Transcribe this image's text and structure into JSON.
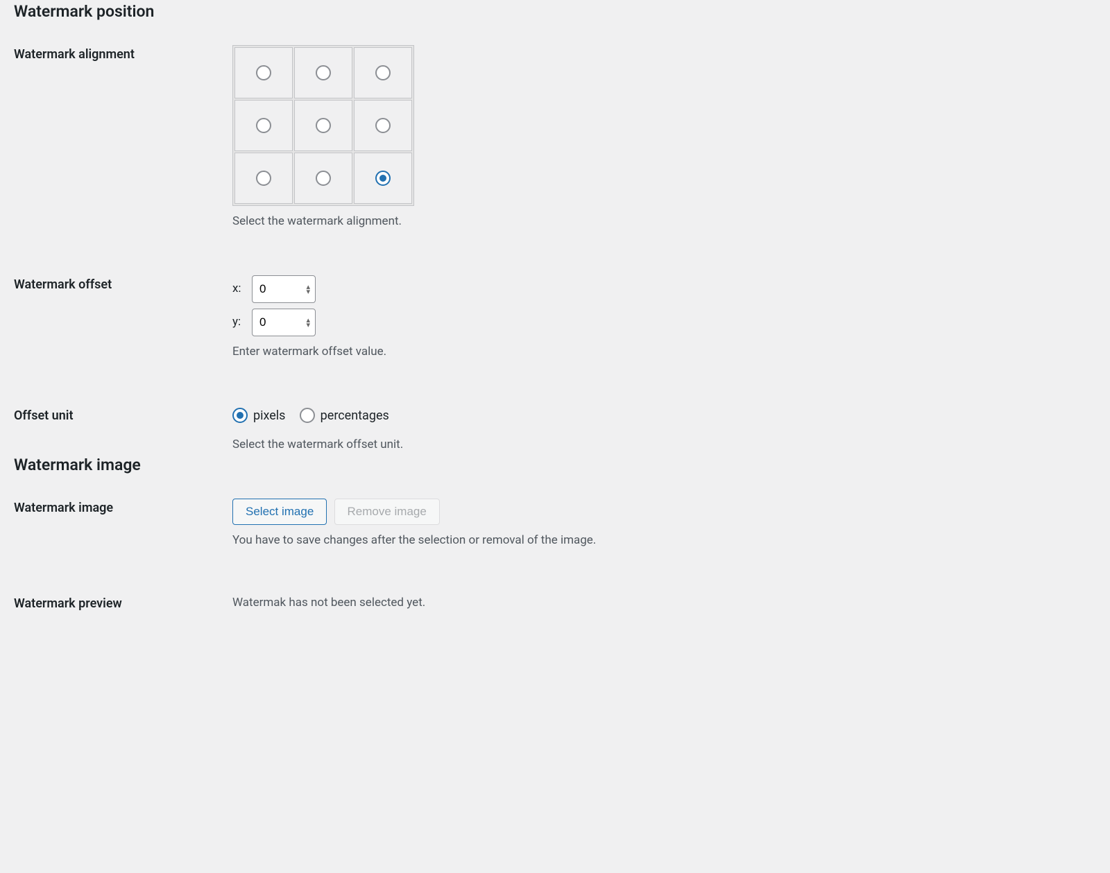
{
  "sections": {
    "position_heading": "Watermark position",
    "image_heading": "Watermark image"
  },
  "alignment": {
    "label": "Watermark alignment",
    "description": "Select the watermark alignment.",
    "selected": "bottom_right"
  },
  "offset": {
    "label": "Watermark offset",
    "x_label": "x:",
    "y_label": "y:",
    "x_value": "0",
    "y_value": "0",
    "description": "Enter watermark offset value."
  },
  "offset_unit": {
    "label": "Offset unit",
    "selected": "pixels",
    "options": {
      "pixels": "pixels",
      "percentages": "percentages"
    },
    "description": "Select the watermark offset unit."
  },
  "image": {
    "label": "Watermark image",
    "select_button": "Select image",
    "remove_button": "Remove image",
    "description": "You have to save changes after the selection or removal of the image."
  },
  "preview": {
    "label": "Watermark preview",
    "text": "Watermak has not been selected yet."
  }
}
